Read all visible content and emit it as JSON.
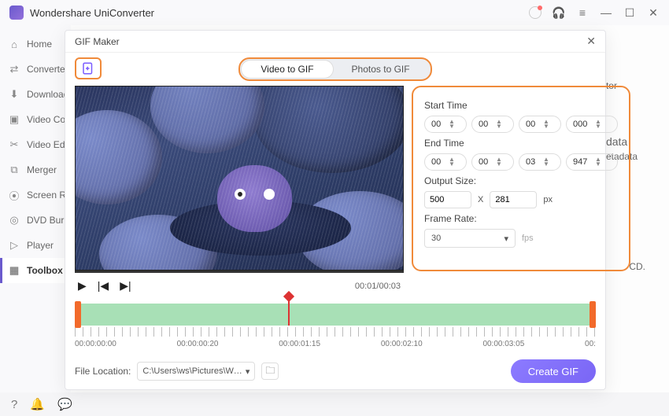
{
  "app": {
    "title": "Wondershare UniConverter"
  },
  "sidebar": {
    "items": [
      {
        "label": "Home"
      },
      {
        "label": "Converter"
      },
      {
        "label": "Downloader"
      },
      {
        "label": "Video Compressor"
      },
      {
        "label": "Video Editor"
      },
      {
        "label": "Merger"
      },
      {
        "label": "Screen Recorder"
      },
      {
        "label": "DVD Burner"
      },
      {
        "label": "Player"
      },
      {
        "label": "Toolbox"
      }
    ]
  },
  "bg": {
    "tor": "tor",
    "meta": "data",
    "meta_sub": "etadata",
    "cd": "CD."
  },
  "dialog": {
    "title": "GIF Maker",
    "tabs": {
      "video": "Video to GIF",
      "photos": "Photos to GIF"
    },
    "time": {
      "start_label": "Start Time",
      "end_label": "End Time",
      "start": {
        "h": "00",
        "m": "00",
        "s": "00",
        "ms": "000"
      },
      "end": {
        "h": "00",
        "m": "00",
        "s": "03",
        "ms": "947"
      }
    },
    "output": {
      "label": "Output Size:",
      "w": "500",
      "x": "X",
      "h": "281",
      "unit": "px"
    },
    "fps": {
      "label": "Frame Rate:",
      "value": "30",
      "unit": "fps"
    },
    "play": {
      "time": "00:01/00:03"
    },
    "timeline": {
      "labels": [
        "00:00:00:00",
        "00:00:00:20",
        "00:00:01:15",
        "00:00:02:10",
        "00:00:03:05",
        "00:"
      ]
    },
    "file": {
      "label": "File Location:",
      "path": "C:\\Users\\ws\\Pictures\\Wonders"
    },
    "create": "Create GIF"
  }
}
